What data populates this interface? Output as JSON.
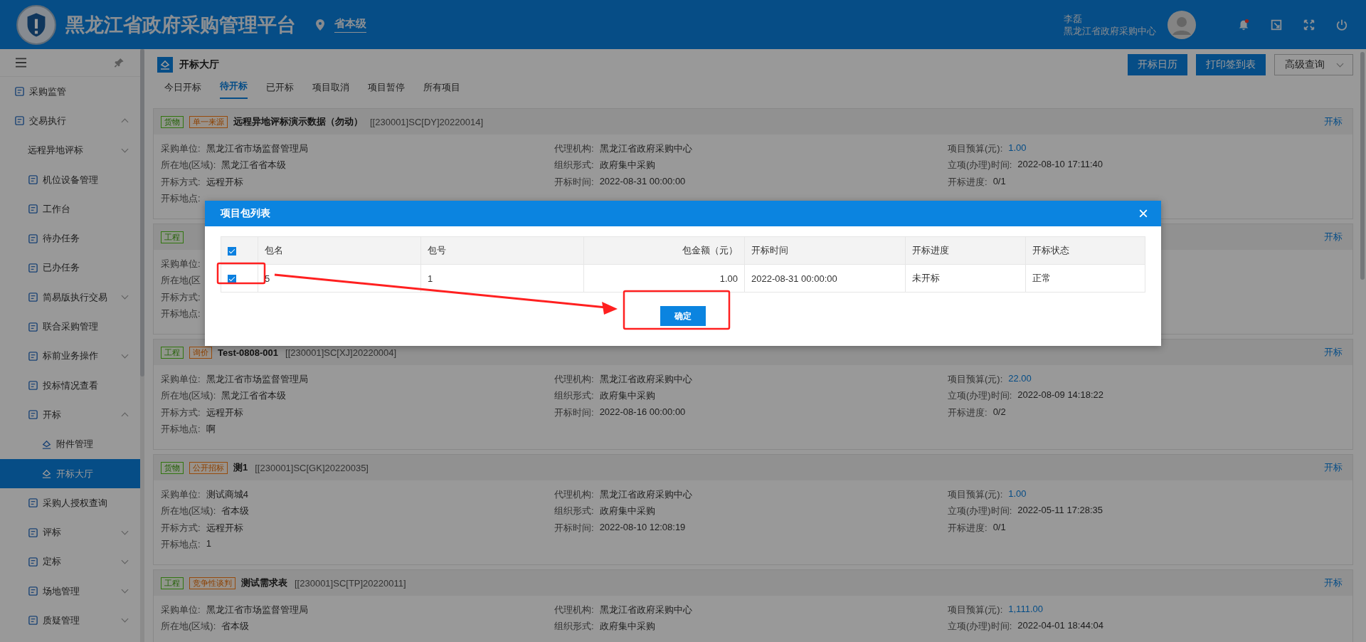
{
  "header": {
    "title": "黑龙江省政府采购管理平台",
    "region": "省本级",
    "user_name": "李磊",
    "user_org": "黑龙江省政府采购中心",
    "notification_badge": true
  },
  "sidebar": {
    "items": [
      {
        "label": "采购监管"
      },
      {
        "label": "交易执行",
        "expanded": true,
        "selected": false,
        "children": [
          {
            "label": "远程异地评标",
            "expanded": false
          },
          {
            "label": "机位设备管理"
          },
          {
            "label": "工作台"
          },
          {
            "label": "待办任务"
          },
          {
            "label": "已办任务"
          },
          {
            "label": "简易版执行交易",
            "expanded": false
          },
          {
            "label": "联合采购管理"
          },
          {
            "label": "标前业务操作",
            "expanded": false
          },
          {
            "label": "投标情况查看"
          },
          {
            "label": "开标",
            "expanded": true,
            "children": [
              {
                "label": "附件管理",
                "selected": false
              },
              {
                "label": "开标大厅",
                "selected": true
              }
            ]
          },
          {
            "label": "采购人授权查询"
          },
          {
            "label": "评标",
            "expanded": false
          },
          {
            "label": "定标",
            "expanded": false
          },
          {
            "label": "场地管理",
            "expanded": false
          },
          {
            "label": "质疑管理",
            "expanded": false
          }
        ]
      }
    ]
  },
  "page": {
    "title": "开标大厅",
    "buttons": [
      "开标日历",
      "打印签到表"
    ],
    "dropdown": "高级查询"
  },
  "tabs": [
    {
      "label": "今日开标",
      "selected": false
    },
    {
      "label": "待开标",
      "selected": true
    },
    {
      "label": "已开标",
      "selected": false
    },
    {
      "label": "项目取消",
      "selected": false
    },
    {
      "label": "项目暂停",
      "selected": false
    },
    {
      "label": "所有项目",
      "selected": false
    }
  ],
  "cards": [
    {
      "tags": [
        {
          "label": "货物",
          "kind": "category"
        },
        {
          "label": "单一来源",
          "kind": "method"
        }
      ],
      "title": "远程异地评标演示数据（勿动）",
      "code": "[[230001]SC[DY]20220014]",
      "action": "开标",
      "rows": [
        [
          {
            "label": "采购单位:",
            "value": "黑龙江省市场监督管理局"
          },
          {
            "label": "代理机构:",
            "value": "黑龙江省政府采购中心"
          },
          {
            "label": "项目预算(元):",
            "value": "1.00"
          }
        ],
        [
          {
            "label": "所在地(区域):",
            "value": "黑龙江省省本级"
          },
          {
            "label": "组织形式:",
            "value": "政府集中采购"
          },
          {
            "label": "立项(办理)时间:",
            "value": "2022-08-10 17:11:40"
          }
        ],
        [
          {
            "label": "开标方式:",
            "value": "远程开标"
          },
          {
            "label": "开标时间:",
            "value": "2022-08-31 00:00:00"
          },
          {
            "label": "开标进度:",
            "value": "0/1"
          }
        ],
        [
          {
            "label": "开标地点:"
          }
        ]
      ]
    },
    {
      "tags": [
        {
          "label": "工程",
          "kind": "category"
        }
      ],
      "action": "开标",
      "rows": [
        [
          {
            "label": "采购单位:"
          }
        ],
        [
          {
            "label": "所在地(区"
          }
        ],
        [
          {
            "label": "开标方式:"
          }
        ],
        [
          {
            "label": "开标地点:"
          }
        ]
      ]
    },
    {
      "tags": [
        {
          "label": "工程",
          "kind": "category"
        },
        {
          "label": "询价",
          "kind": "method"
        }
      ],
      "title": "Test-0808-001",
      "code": "[[230001]SC[XJ]20220004]",
      "action": "开标",
      "rows": [
        [
          {
            "label": "采购单位:",
            "value": "黑龙江省市场监督管理局"
          },
          {
            "label": "代理机构:",
            "value": "黑龙江省政府采购中心"
          },
          {
            "label": "项目预算(元):",
            "value": "22.00"
          }
        ],
        [
          {
            "label": "所在地(区域):",
            "value": "黑龙江省省本级"
          },
          {
            "label": "组织形式:",
            "value": "政府集中采购"
          },
          {
            "label": "立项(办理)时间:",
            "value": "2022-08-09 14:18:22"
          }
        ],
        [
          {
            "label": "开标方式:",
            "value": "远程开标"
          },
          {
            "label": "开标时间:",
            "value": "2022-08-16 00:00:00"
          },
          {
            "label": "开标进度:",
            "value": "0/2"
          }
        ],
        [
          {
            "label": "开标地点:",
            "value": "啊"
          }
        ]
      ]
    },
    {
      "tags": [
        {
          "label": "货物",
          "kind": "category"
        },
        {
          "label": "公开招标",
          "kind": "method"
        }
      ],
      "title": "测1",
      "code": "[[230001]SC[GK]20220035]",
      "action": "开标",
      "rows": [
        [
          {
            "label": "采购单位:",
            "value": "测试商城4"
          },
          {
            "label": "代理机构:",
            "value": "黑龙江省政府采购中心"
          },
          {
            "label": "项目预算(元):",
            "value": "1.00"
          }
        ],
        [
          {
            "label": "所在地(区域):",
            "value": "省本级"
          },
          {
            "label": "组织形式:",
            "value": "政府集中采购"
          },
          {
            "label": "立项(办理)时间:",
            "value": "2022-05-11 17:28:35"
          }
        ],
        [
          {
            "label": "开标方式:",
            "value": "远程开标"
          },
          {
            "label": "开标时间:",
            "value": "2022-08-10 12:08:19"
          },
          {
            "label": "开标进度:",
            "value": "0/1"
          }
        ],
        [
          {
            "label": "开标地点:",
            "value": "1"
          }
        ]
      ]
    },
    {
      "tags": [
        {
          "label": "工程",
          "kind": "category"
        },
        {
          "label": "竞争性谈判",
          "kind": "method"
        }
      ],
      "title": "测试需求表",
      "code": "[[230001]SC[TP]20220011]",
      "action": "开标",
      "rows": [
        [
          {
            "label": "采购单位:",
            "value": "黑龙江省市场监督管理局"
          },
          {
            "label": "代理机构:",
            "value": "黑龙江省政府采购中心"
          },
          {
            "label": "项目预算(元):",
            "value": "1,111.00"
          }
        ],
        [
          {
            "label": "所在地(区域):",
            "value": "省本级"
          },
          {
            "label": "组织形式:",
            "value": "政府集中采购"
          },
          {
            "label": "立项(办理)时间:",
            "value": "2022-04-01 18:44:04"
          }
        ]
      ]
    }
  ],
  "modal": {
    "title": "项目包列表",
    "close": "×",
    "columns": [
      "包名",
      "包号",
      "包金额（元）",
      "开标时间",
      "开标进度",
      "开标状态"
    ],
    "all_checked": true,
    "rows": [
      {
        "checked": true,
        "cells": [
          "5",
          "1",
          "1.00",
          "2022-08-31 00:00:00",
          "未开标",
          "正常"
        ]
      }
    ],
    "confirm": "确定"
  }
}
